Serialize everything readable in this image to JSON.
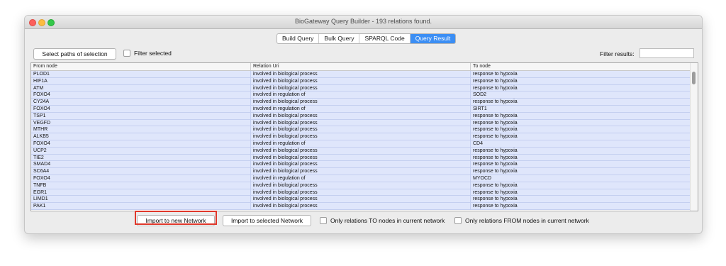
{
  "window": {
    "title": "BioGateway Query Builder - 193 relations found."
  },
  "tabs": [
    "Build Query",
    "Bulk Query",
    "SPARQL Code",
    "Query Result"
  ],
  "active_tab": "Query Result",
  "toolbar": {
    "select_paths_label": "Select paths of selection",
    "filter_selected_label": "Filter selected",
    "filter_results_label": "Filter results:",
    "filter_results_value": ""
  },
  "table": {
    "columns": [
      "From node",
      "Relation Uri",
      "To node"
    ],
    "rows": [
      [
        "PLOD1",
        "involved in biological process",
        "response to hypoxia"
      ],
      [
        "HIF1A",
        "involved in biological process",
        "response to hypoxia"
      ],
      [
        "ATM",
        "involved in biological process",
        "response to hypoxia"
      ],
      [
        "FOXO4",
        "involved in regulation of",
        "SOD2"
      ],
      [
        "CY24A",
        "involved in biological process",
        "response to hypoxia"
      ],
      [
        "FOXO4",
        "involved in regulation of",
        "SIRT1"
      ],
      [
        "TSP1",
        "involved in biological process",
        "response to hypoxia"
      ],
      [
        "VEGFD",
        "involved in biological process",
        "response to hypoxia"
      ],
      [
        "MTHR",
        "involved in biological process",
        "response to hypoxia"
      ],
      [
        "ALKB5",
        "involved in biological process",
        "response to hypoxia"
      ],
      [
        "FOXO4",
        "involved in regulation of",
        "CD4"
      ],
      [
        "UCP2",
        "involved in biological process",
        "response to hypoxia"
      ],
      [
        "TIE2",
        "involved in biological process",
        "response to hypoxia"
      ],
      [
        "SMAD4",
        "involved in biological process",
        "response to hypoxia"
      ],
      [
        "SC6A4",
        "involved in biological process",
        "response to hypoxia"
      ],
      [
        "FOXO4",
        "involved in regulation of",
        "MYOCD"
      ],
      [
        "TNFB",
        "involved in biological process",
        "response to hypoxia"
      ],
      [
        "EGR1",
        "involved in biological process",
        "response to hypoxia"
      ],
      [
        "LIMD1",
        "involved in biological process",
        "response to hypoxia"
      ],
      [
        "PAK1",
        "involved in biological process",
        "response to hypoxia"
      ]
    ]
  },
  "bottom": {
    "import_new_label": "Import to new Network",
    "import_selected_label": "Import to selected Network",
    "only_to_label": "Only relations TO nodes in current network",
    "only_from_label": "Only relations FROM nodes in current network"
  },
  "colors": {
    "accent": "#3b8ef4",
    "row_selected": "#dfe6fb",
    "highlight": "#e0382b"
  }
}
